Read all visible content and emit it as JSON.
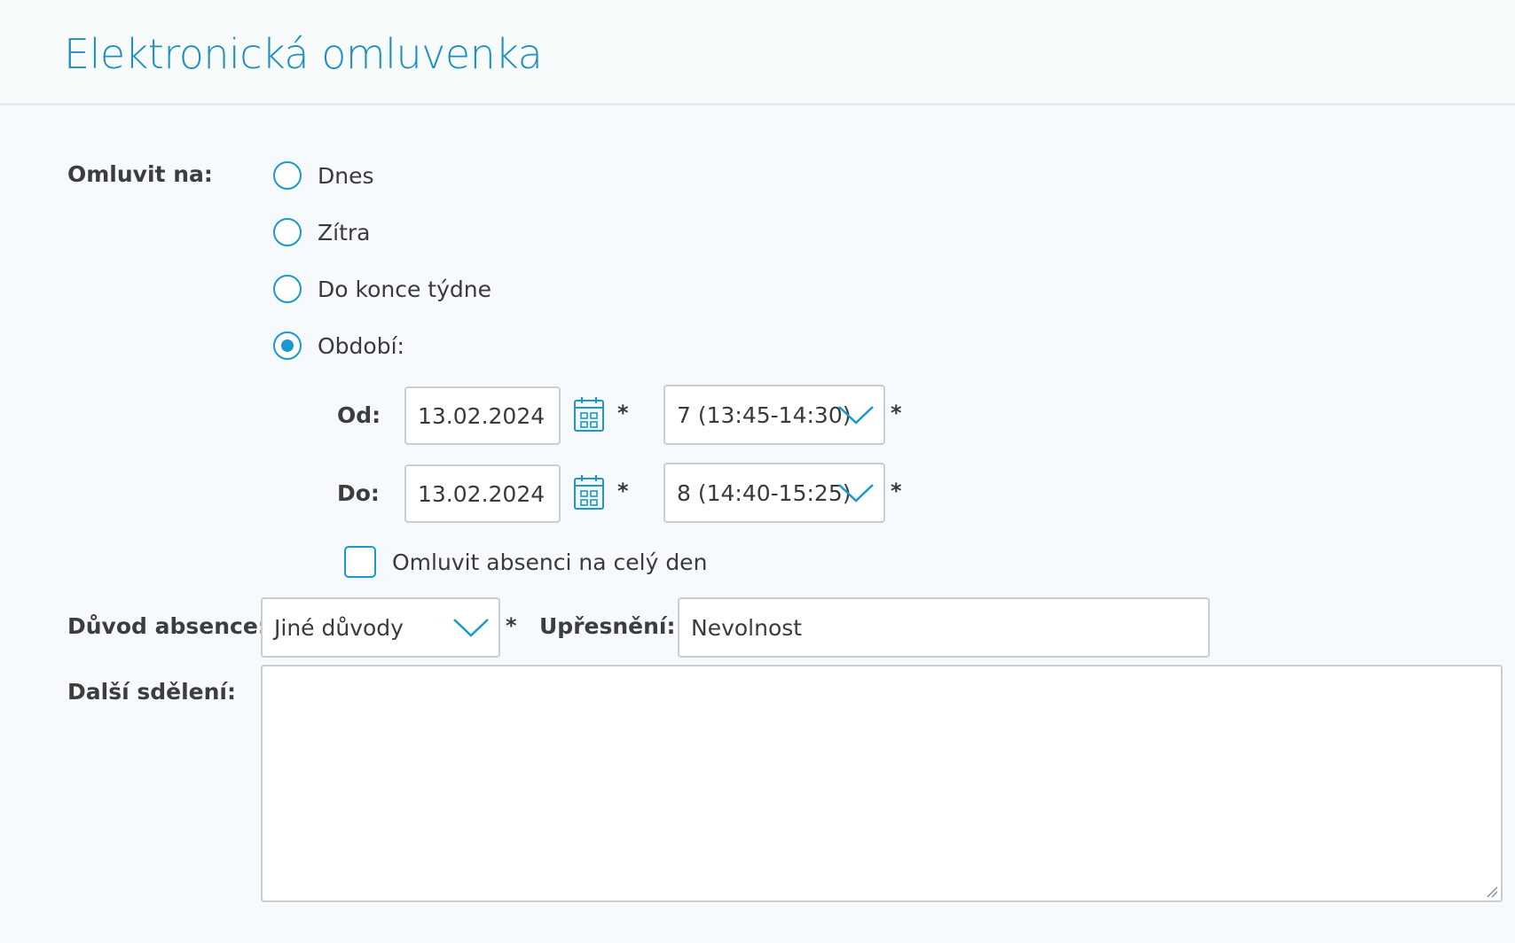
{
  "page": {
    "title": "Elektronická omluvenka"
  },
  "excuse_for": {
    "label": "Omluvit na:",
    "options": [
      {
        "label": "Dnes",
        "checked": false
      },
      {
        "label": "Zítra",
        "checked": false
      },
      {
        "label": "Do konce týdne",
        "checked": false
      },
      {
        "label": "Období:",
        "checked": true
      }
    ]
  },
  "period": {
    "from": {
      "label": "Od:",
      "date": "13.02.2024",
      "lesson": "7 (13:45-14:30)"
    },
    "to": {
      "label": "Do:",
      "date": "13.02.2024",
      "lesson": "8 (14:40-15:25)"
    },
    "required_mark": "*",
    "calendar_icon": "calendar-icon"
  },
  "whole_day": {
    "label": "Omluvit absenci na celý den",
    "checked": false
  },
  "reason": {
    "label": "Důvod absence:",
    "value": "Jiné důvody",
    "required_mark": "*"
  },
  "detail": {
    "label": "Upřesnění:",
    "value": "Nevolnost"
  },
  "message": {
    "label": "Další sdělení:",
    "value": ""
  },
  "colors": {
    "accent": "#1a98cf",
    "title": "#1f8fc0",
    "border": "#c9ced3",
    "background": "#f7fafc"
  }
}
